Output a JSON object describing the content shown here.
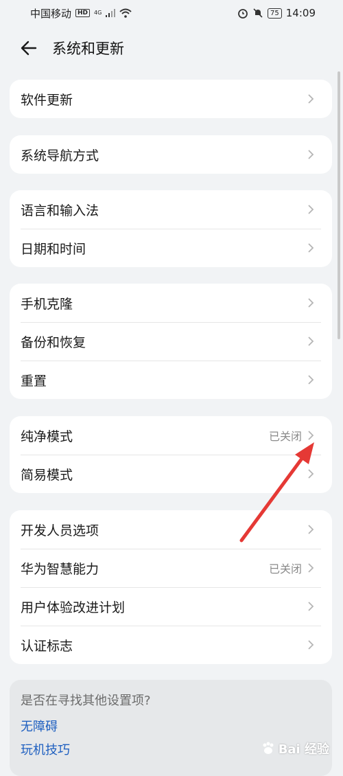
{
  "status_bar": {
    "carrier": "中国移动",
    "hd": "HD",
    "network": "4G",
    "battery": "75",
    "time": "14:09"
  },
  "header": {
    "title": "系统和更新",
    "back_icon": "back-arrow-icon"
  },
  "groups": [
    {
      "items": [
        {
          "label": "软件更新",
          "value": ""
        }
      ]
    },
    {
      "items": [
        {
          "label": "系统导航方式",
          "value": ""
        }
      ]
    },
    {
      "items": [
        {
          "label": "语言和输入法",
          "value": ""
        },
        {
          "label": "日期和时间",
          "value": ""
        }
      ]
    },
    {
      "items": [
        {
          "label": "手机克隆",
          "value": ""
        },
        {
          "label": "备份和恢复",
          "value": ""
        },
        {
          "label": "重置",
          "value": ""
        }
      ]
    },
    {
      "items": [
        {
          "label": "纯净模式",
          "value": "已关闭"
        },
        {
          "label": "简易模式",
          "value": ""
        }
      ]
    },
    {
      "items": [
        {
          "label": "开发人员选项",
          "value": ""
        },
        {
          "label": "华为智慧能力",
          "value": "已关闭"
        },
        {
          "label": "用户体验改进计划",
          "value": ""
        },
        {
          "label": "认证标志",
          "value": ""
        }
      ]
    }
  ],
  "suggestions": {
    "title": "是否在寻找其他设置项?",
    "links": [
      "无障碍",
      "玩机技巧"
    ]
  },
  "watermark": {
    "text": "Bai 经验"
  },
  "colors": {
    "background": "#f1f3f5",
    "card": "#ffffff",
    "link": "#1e5fc0",
    "annotation_arrow": "#e53935"
  }
}
